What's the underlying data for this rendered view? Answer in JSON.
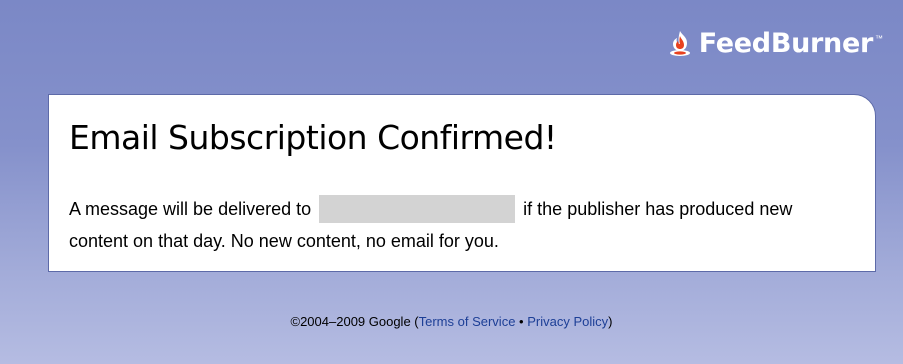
{
  "brand": {
    "name": "FeedBurner",
    "trademark": "™",
    "icon": "feedburner-flame-icon"
  },
  "confirmation": {
    "title": "Email Subscription Confirmed!",
    "message_before": "A message will be delivered to",
    "message_after": "if the publisher has produced new content on that day. No new content, no email for you."
  },
  "footer": {
    "copyright": "©2004–2009 Google (",
    "terms_label": "Terms of Service",
    "separator": " • ",
    "privacy_label": "Privacy Policy",
    "close_paren": ")"
  },
  "colors": {
    "background": "#8591cb",
    "panel_border": "#5d6aa8",
    "link": "#1d3f96",
    "redaction": "#d3d3d3"
  }
}
